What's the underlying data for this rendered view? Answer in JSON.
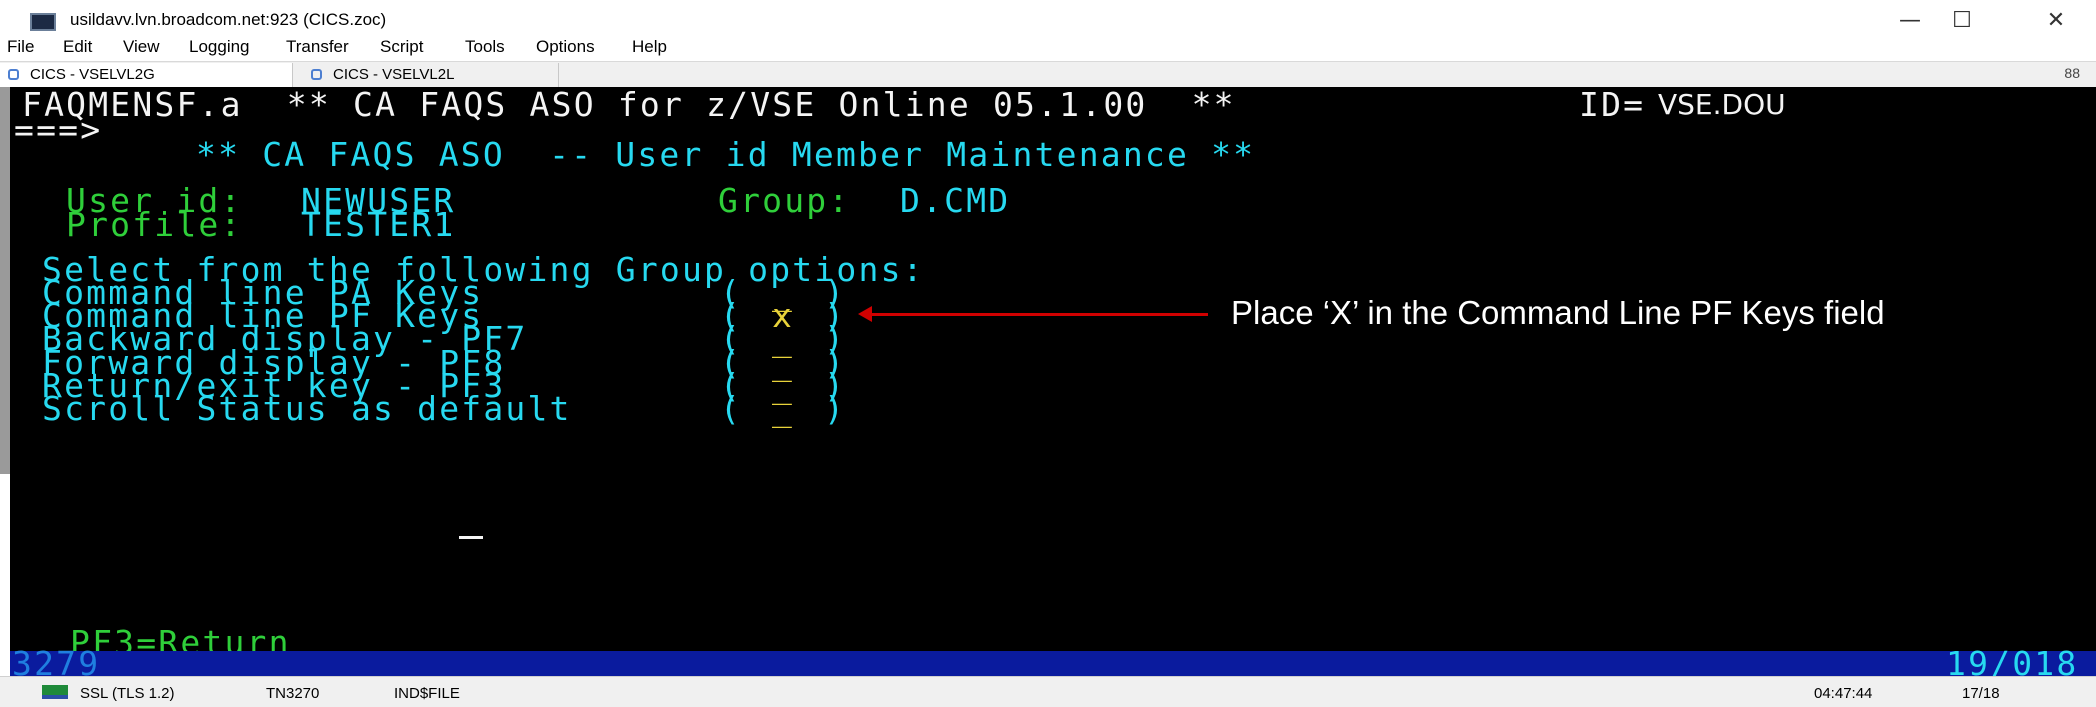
{
  "window": {
    "title": "usildavv.lvn.broadcom.net:923 (CICS.zoc)",
    "minimize": "—",
    "maximize": "☐",
    "close": "✕"
  },
  "menu": [
    "File",
    "Edit",
    "View",
    "Logging",
    "Transfer",
    "Script",
    "Tools",
    "Options",
    "Help"
  ],
  "tabs": [
    {
      "label": "CICS - VSELVL2G",
      "active": true
    },
    {
      "label": "CICS - VSELVL2L",
      "active": false
    }
  ],
  "tab_badge": "88",
  "terminal": {
    "line1": "FAQMENSF.a  ** CA FAQS ASO for z/VSE Online 05.1.00  **",
    "id_label": "ID=",
    "id_value": "VSE.DOU",
    "prompt": "===>",
    "heading": "** CA FAQS ASO  -- User id Member Maintenance **",
    "userid_label": "User id:",
    "userid_value": "NEWUSER",
    "group_label": "Group:",
    "group_value": "D.CMD",
    "profile_label": "Profile:",
    "profile_value": "TESTER1",
    "select_prompt": "Select from the following Group options:",
    "options": [
      {
        "label": "Command line PA Keys",
        "value": "_"
      },
      {
        "label": "Command line PF Keys",
        "value": "x"
      },
      {
        "label": "Backward display - PF7",
        "value": "_"
      },
      {
        "label": "Forward display - PF8",
        "value": "_"
      },
      {
        "label": "Return/exit key - PF3",
        "value": "_"
      },
      {
        "label": "Scroll Status as default",
        "value": "_"
      }
    ],
    "pf3": "PF3=Return",
    "model": "3279",
    "cursor_pos": "19/018"
  },
  "annotation": "Place ‘X’ in the Command Line PF Keys field",
  "bottom_status": {
    "ssl": "SSL (TLS 1.2)",
    "emulation": "TN3270",
    "transfer": "IND$FILE",
    "time": "04:47:44",
    "position": "17/18"
  },
  "colors": {
    "terminal_bg": "#000000",
    "protected_text": "#f4f4f4",
    "field_label": "#2fcf3a",
    "field_value": "#27d9f0",
    "input": "#e8d23a",
    "status_bar": "#0a1b9e",
    "annotation_arrow": "#d10000"
  }
}
